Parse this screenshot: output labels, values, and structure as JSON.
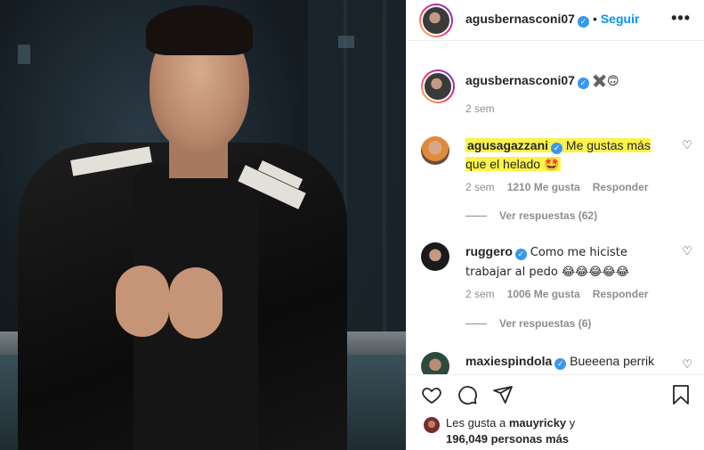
{
  "header": {
    "username": "agusbernasconi07",
    "follow_label": "Seguir",
    "more_label": "•••"
  },
  "caption": {
    "username": "agusbernasconi07",
    "text": "✖️🙃",
    "time": "2 sem"
  },
  "comments": [
    {
      "username": "agusagazzani",
      "text": "Me gustas más que el helado 🤩",
      "time": "2 sem",
      "likes": "1210 Me gusta",
      "reply_label": "Responder",
      "view_replies": "Ver respuestas (62)"
    },
    {
      "username": "ruggero",
      "text": "Como me hiciste trabajar al pedo 😂😂😂😂😂",
      "time": "2 sem",
      "likes": "1006 Me gusta",
      "reply_label": "Responder",
      "view_replies": "Ver respuestas (6)"
    },
    {
      "username": "maxiespindola",
      "text": "Bueeena perrik"
    }
  ],
  "footer": {
    "likes_prefix": "Les gusta a",
    "likes_user": "mauyricky",
    "likes_conj": "y",
    "likes_count": "196,049 personas más"
  },
  "icons": {
    "verified": "verified-badge-icon",
    "heart": "heart-icon",
    "comment": "comment-bubble-icon",
    "share": "paper-plane-icon",
    "save": "bookmark-icon"
  },
  "colors": {
    "accent": "#0095f6",
    "verified": "#3897f0",
    "highlight": "#fbf34a"
  }
}
